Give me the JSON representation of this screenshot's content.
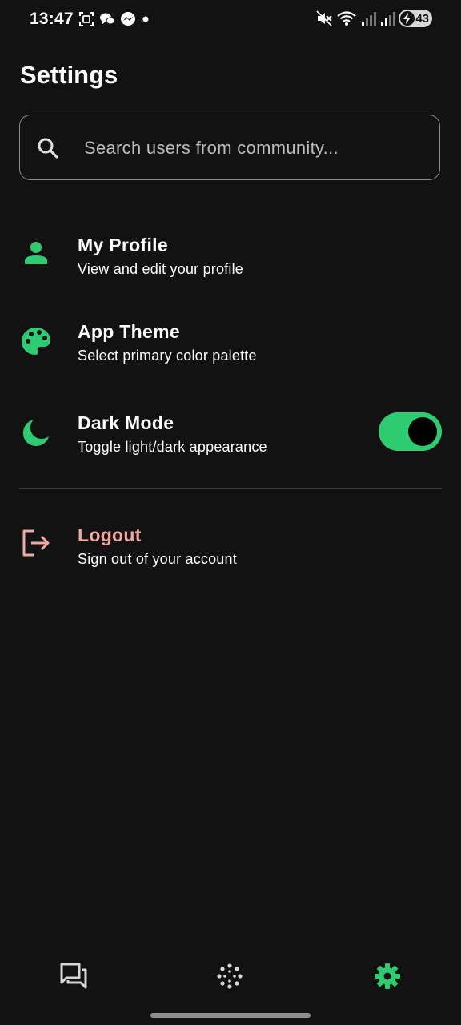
{
  "status_bar": {
    "time": "13:47",
    "battery": "43",
    "left_icons": [
      "screenshot-icon",
      "chat-bubbles-icon",
      "messenger-icon",
      "dot-icon"
    ],
    "right_icons": [
      "mute-icon",
      "wifi-icon",
      "signal-icon",
      "signal-icon",
      "battery-icon"
    ]
  },
  "page": {
    "title": "Settings"
  },
  "search": {
    "placeholder": "Search users from community...",
    "value": "",
    "icon": "search-icon"
  },
  "items": [
    {
      "title": "My Profile",
      "subtitle": "View and edit your profile",
      "icon": "person-icon"
    },
    {
      "title": "App Theme",
      "subtitle": "Select primary color palette",
      "icon": "palette-icon"
    },
    {
      "title": "Dark Mode",
      "subtitle": "Toggle light/dark appearance",
      "icon": "moon-icon",
      "toggle_on": true
    }
  ],
  "logout": {
    "title": "Logout",
    "subtitle": "Sign out of your account",
    "icon": "logout-icon"
  },
  "bottom_nav": [
    {
      "icon": "chat-icon",
      "active": false
    },
    {
      "icon": "explore-icon",
      "active": false
    },
    {
      "icon": "settings-gear-icon",
      "active": true
    }
  ],
  "colors": {
    "background": "#121212",
    "accent": "#2ecc71",
    "logout": "#f0a8a0",
    "text": "#ffffff",
    "muted": "#bdbdbd"
  }
}
